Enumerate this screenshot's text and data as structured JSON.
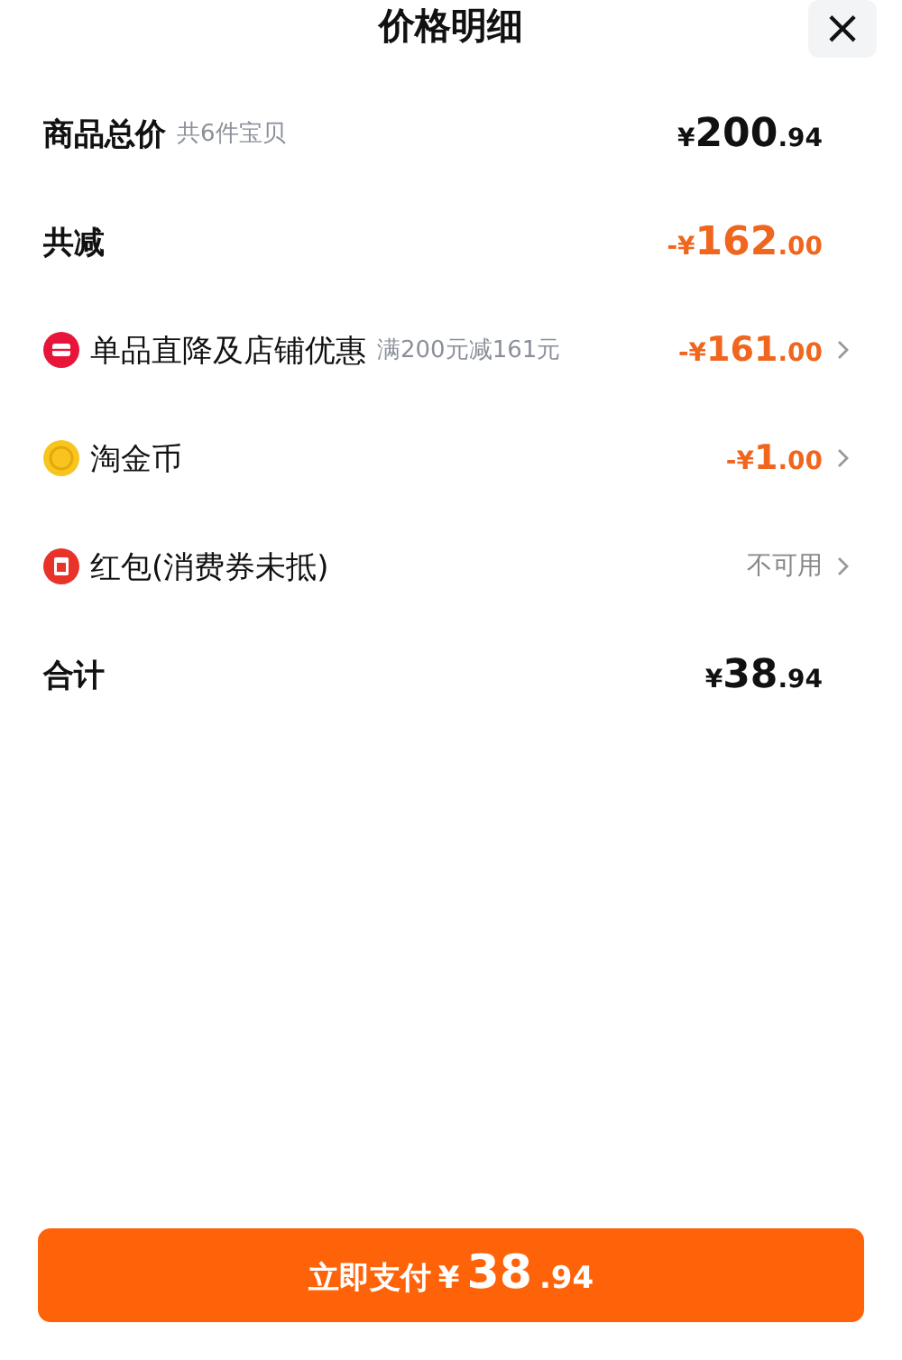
{
  "header": {
    "title": "价格明细",
    "close": "×"
  },
  "rows": [
    {
      "kind": "summary",
      "label": "商品总价",
      "note": "共6件宝贝",
      "price": {
        "prefix": "¥",
        "whole": "200",
        "fraction": ".94"
      },
      "highlight": false
    },
    {
      "kind": "summary",
      "label": "共减",
      "price": {
        "prefix": "-¥",
        "whole": "162",
        "fraction": ".00"
      },
      "highlight": true
    },
    {
      "kind": "discount",
      "label": "单品直降及店铺优惠",
      "note": "满200元减161元",
      "price": {
        "prefix": "-¥",
        "whole": "161",
        "fraction": ".00"
      },
      "highlight": true
    },
    {
      "kind": "discount",
      "label": "淘金币",
      "price": {
        "prefix": "-¥",
        "whole": "1",
        "fraction": ".00"
      },
      "highlight": true
    },
    {
      "kind": "discount",
      "label": "红包(消费券未抵)",
      "status": "不可用"
    },
    {
      "kind": "summary",
      "label": "合计",
      "price": {
        "prefix": "¥",
        "whole": "38",
        "fraction": ".94"
      },
      "highlight": false
    }
  ],
  "pay_button": {
    "label": "立即支付",
    "price": {
      "prefix": "¥",
      "whole": "38",
      "fraction": ".94"
    }
  }
}
